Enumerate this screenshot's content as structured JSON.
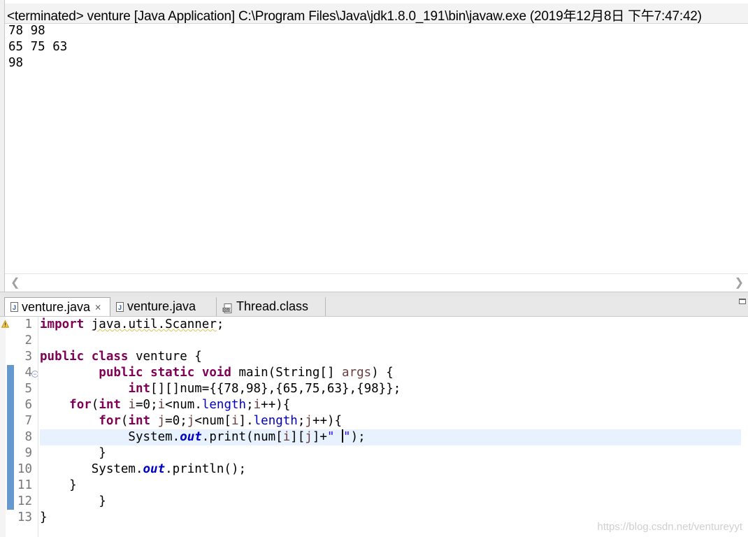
{
  "console": {
    "header": "<terminated> venture [Java Application] C:\\Program Files\\Java\\jdk1.8.0_191\\bin\\javaw.exe (2019年12月8日 下午7:47:42)",
    "output_lines": [
      "78 98",
      "65 75 63",
      "98"
    ]
  },
  "tabs": [
    {
      "label": "venture.java",
      "icon": "java-file-icon",
      "active": true,
      "closable": true
    },
    {
      "label": "venture.java",
      "icon": "java-file-icon",
      "active": false,
      "closable": false
    },
    {
      "label": "Thread.class",
      "icon": "class-file-icon",
      "active": false,
      "closable": false
    }
  ],
  "editor": {
    "line_numbers": [
      "1",
      "2",
      "3",
      "4",
      "5",
      "6",
      "7",
      "8",
      "9",
      "10",
      "11",
      "12",
      "13"
    ],
    "current_line": 8,
    "code_lines": [
      "import java.util.Scanner;",
      "",
      "public class venture {",
      "        public static void main(String[] args) {",
      "            int[][]num={{78,98},{65,75,63},{98}};",
      "    for(int i=0;i<num.length;i++){",
      "        for(int j=0;j<num[i].length;j++){",
      "            System.out.print(num[i][j]+\" \");",
      "        }",
      "       System.out.println();",
      "    }",
      "        }",
      "}"
    ]
  },
  "watermark": "https://blog.csdn.net/ventureyyt",
  "colors": {
    "keyword": "#7f0055",
    "field": "#0000c0",
    "variable": "#6a3e3e",
    "string": "#2a00ff",
    "line_number": "#787878",
    "current_line_bg": "#e8f2fe",
    "change_bar": "#4a87c6"
  }
}
